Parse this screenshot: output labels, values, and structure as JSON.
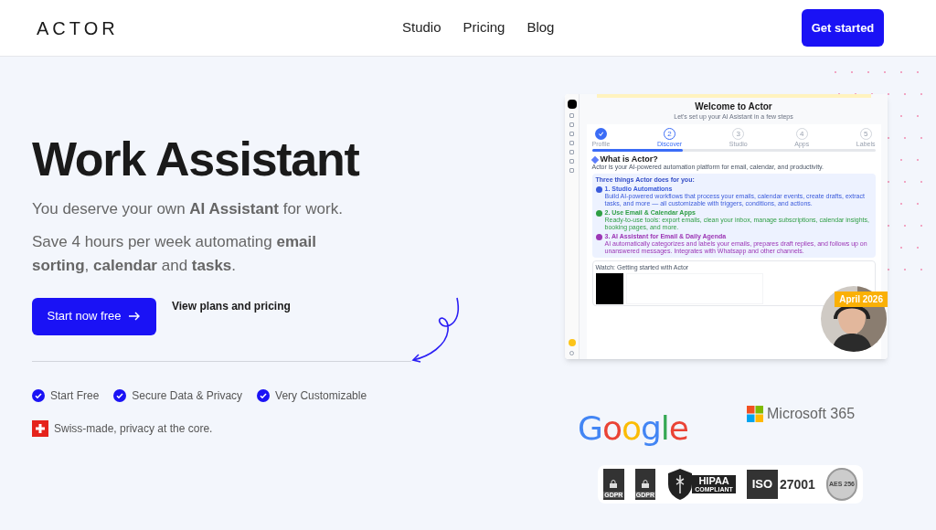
{
  "header": {
    "logo": "ACTOR",
    "nav": [
      {
        "label": "Studio"
      },
      {
        "label": "Pricing"
      },
      {
        "label": "Blog"
      }
    ],
    "cta": "Get started"
  },
  "hero": {
    "title": "Work Assistant",
    "lead": "You deserve your own **AI Assistant** for work.",
    "sub": "Save 4 hours per week automating **email sorting**, **calendar** and **tasks**.",
    "primary": "Start now free",
    "secondary": "View plans and pricing",
    "features": [
      {
        "label": "Start Free"
      },
      {
        "label": "Secure Data & Privacy"
      },
      {
        "label": "Very Customizable"
      }
    ],
    "swiss": "Swiss-made, privacy at the core."
  },
  "app": {
    "title": "Welcome to Actor",
    "subtitle": "Let's set up your AI Asistant in a few steps",
    "steps": [
      {
        "label": "Profile",
        "done": true,
        "selected": false
      },
      {
        "number": "2",
        "label": "Discover",
        "done": false,
        "selected": true
      },
      {
        "number": "3",
        "label": "Studio",
        "done": false,
        "selected": false
      },
      {
        "number": "4",
        "label": "Apps",
        "done": false,
        "selected": false
      },
      {
        "number": "5",
        "label": "Labels",
        "done": false,
        "selected": false
      }
    ],
    "progress": {
      "level": 0.32
    },
    "heading": "What is Actor?",
    "intro": "Actor is your AI-powered automation platform for email, calendar, and productivity.",
    "box_title": "Three things Actor does for you:",
    "items": [
      {
        "title": "1. Studio Automations",
        "text": "Build AI-powered workflows that process your emails, calendar events, create drafts, extract tasks, and more — all customizable with triggers, conditions, and actions.",
        "color": "#3b5bdb"
      },
      {
        "title": "2. Use Email & Calendar Apps",
        "text": "Ready-to-use tools: export emails, clean your inbox, manage subscriptions, calendar insights, booking pages, and more.",
        "color": "#2f9e44"
      },
      {
        "title": "3. AI Assistant for Email & Daily Agenda",
        "text": "AI automatically categorizes and labels your emails, prepares draft replies, and follows up on unanswered messages. Integrates with Whatsapp and other channels.",
        "color": "#9c36b5"
      }
    ],
    "video_title": "Watch: Getting started with Actor",
    "badge": "April 2026"
  },
  "partners": {
    "google": "Google",
    "microsoft": "Microsoft 365"
  },
  "certs": [
    {
      "kind": "gdpr",
      "label": "GDPR"
    },
    {
      "kind": "gdpr",
      "label": "GDPR"
    },
    {
      "kind": "hipaa",
      "label": "HIPAA",
      "sub": "COMPLIANT"
    },
    {
      "kind": "iso",
      "label": "ISO",
      "sub": "27001"
    },
    {
      "kind": "aes",
      "label": "AES 256"
    }
  ]
}
